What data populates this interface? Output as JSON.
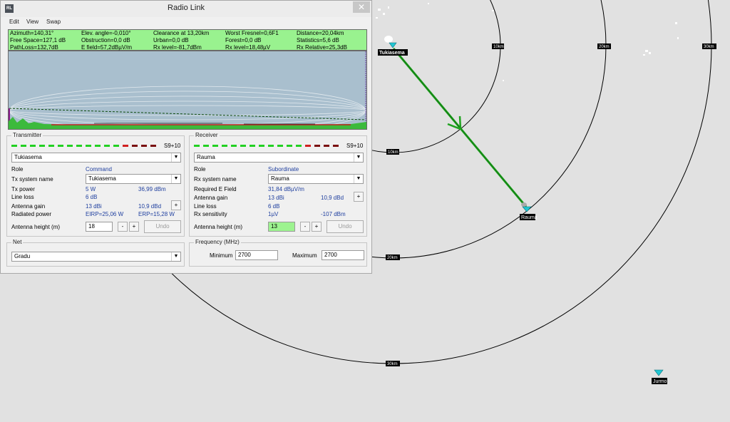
{
  "window": {
    "title": "Radio Link",
    "close_label": "✕",
    "menu": [
      "Edit",
      "View",
      "Swap"
    ]
  },
  "stats": [
    [
      "Azimuth=140,31°",
      "Elev. angle=-0,010°",
      "Clearance at 13,20km",
      "Worst Fresnel=0,6F1",
      "Distance=20,04km"
    ],
    [
      "Free Space=127,1 dB",
      "Obstruction=0,0 dB",
      "Urban=0,0 dB",
      "Forest=0,0 dB",
      "Statistics=5,6 dB"
    ],
    [
      "PathLoss=132,7dB",
      "E field=57,2dBµV/m",
      "Rx level=-81,7dBm",
      "Rx level=18,48µV",
      "Rx Relative=25,3dB"
    ]
  ],
  "transmitter": {
    "title": "Transmitter",
    "meter_label": "S9+10",
    "site": "Tukiasema",
    "role_label": "Role",
    "role_value": "Command",
    "system_label": "Tx system name",
    "system_value": "Tukiasema",
    "power_label": "Tx power",
    "power_w": "5 W",
    "power_dbm": "36,99 dBm",
    "lineloss_label": "Line loss",
    "lineloss_value": "6 dB",
    "gain_label": "Antenna gain",
    "gain_dbi": "13 dBi",
    "gain_dbd": "10,9 dBd",
    "plus_label": "+",
    "radiated_label": "Radiated power",
    "eirp": "EIRP=25,06 W",
    "erp": "ERP=15,28 W",
    "height_label": "Antenna height (m)",
    "height_value": "18",
    "minus_label": "-",
    "undo_label": "Undo"
  },
  "receiver": {
    "title": "Receiver",
    "meter_label": "S9+10",
    "site": "Rauma",
    "role_label": "Role",
    "role_value": "Subordinate",
    "system_label": "Rx system name",
    "system_value": "Rauma",
    "efield_label": "Required E Field",
    "efield_value": "31,84 dBµV/m",
    "gain_label": "Antenna gain",
    "gain_dbi": "13 dBi",
    "gain_dbd": "10,9 dBd",
    "plus_label": "+",
    "lineloss_label": "Line loss",
    "lineloss_value": "6 dB",
    "sens_label": "Rx sensitivity",
    "sens_uv": "1µV",
    "sens_dbm": "-107 dBm",
    "height_label": "Antenna height (m)",
    "height_value": "13",
    "minus_label": "-",
    "undo_label": "Undo"
  },
  "net": {
    "title": "Net",
    "value": "Gradu"
  },
  "frequency": {
    "title": "Frequency (MHz)",
    "min_label": "Minimum",
    "min_value": "2700",
    "max_label": "Maximum",
    "max_value": "2700"
  },
  "map": {
    "sites": [
      {
        "name": "Tukiasema"
      },
      {
        "name": "Rauma"
      },
      {
        "name": "Jurmo"
      }
    ],
    "ring_labels": [
      "10km",
      "20km",
      "30km",
      "10km",
      "20km",
      "30km"
    ],
    "link_color": "#1fa21f",
    "ring_color": "#000000"
  },
  "colors": {
    "stats_bg": "#99f28f",
    "profile_bg": "#a9bfce",
    "meter_green": "#22d022",
    "meter_red": "#d02020",
    "meter_dark": "#7a1010",
    "value_blue": "#1f3f9f"
  }
}
